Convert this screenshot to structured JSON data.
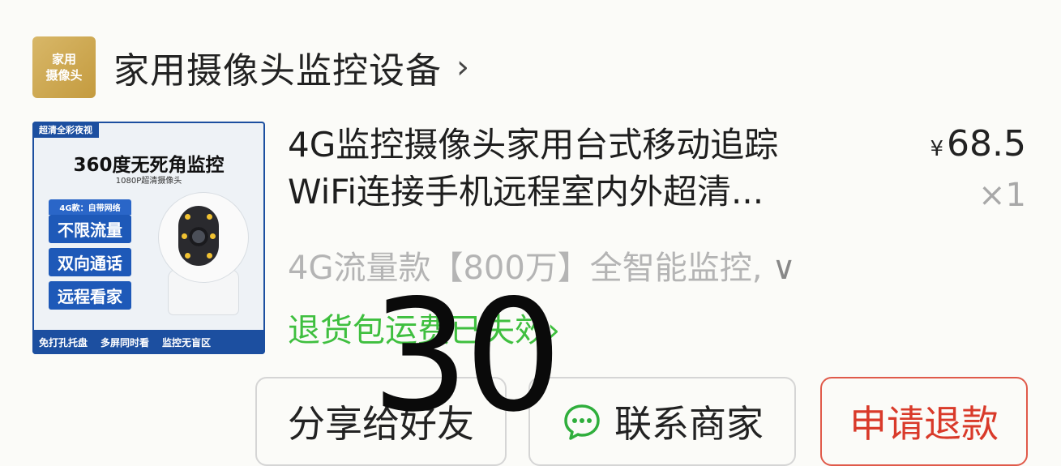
{
  "shop": {
    "logo_line1": "家用",
    "logo_line2": "摄像头",
    "name": "家用摄像头监控设备",
    "chevron": "›"
  },
  "product": {
    "image": {
      "corner_tag": "超清全彩夜视",
      "headline": "360度无死角监控",
      "subhead": "1080P超清摄像头",
      "badge_small": "4G款：自带网络",
      "badge_1": "不限流量",
      "badge_2": "双向通话",
      "badge_3": "远程看家",
      "bottom_left": "免打孔托盘",
      "bottom_mid": "多屏同时看",
      "bottom_right": "监控无盲区"
    },
    "title_line1": "4G监控摄像头家用台式移动追踪",
    "title_line2": "WiFi连接手机远程室内外超清...",
    "currency": "¥",
    "price": "68.5",
    "quantity": "×1",
    "spec": "4G流量款【800万】全智能监控,",
    "spec_chevron": "∨",
    "policy": "退货包运费已失效›"
  },
  "actions": {
    "share": "分享给好友",
    "contact": "联系商家",
    "refund": "申请退款"
  },
  "overlay": {
    "number": "30"
  },
  "colors": {
    "policy_green": "#3fbf3f",
    "refund_red": "#d93a2a",
    "logo_gold": "#c49b3f"
  }
}
